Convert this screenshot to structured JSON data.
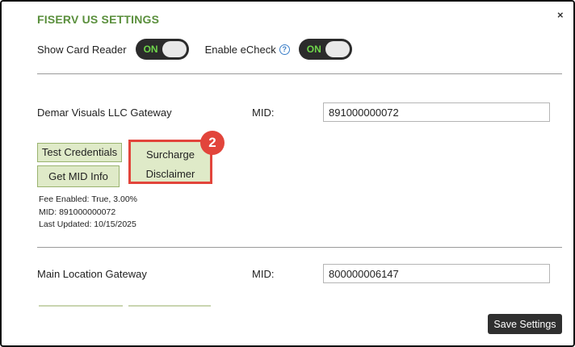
{
  "header": {
    "title": "FISERV US SETTINGS",
    "close_glyph": "×"
  },
  "toggles": {
    "card_reader": {
      "label": "Show Card Reader",
      "state": "ON"
    },
    "echeck": {
      "label": "Enable eCheck",
      "help_glyph": "?",
      "state": "ON"
    }
  },
  "gateways": [
    {
      "name": "Demar Visuals LLC Gateway",
      "mid_label": "MID:",
      "mid_value": "891000000072",
      "buttons": {
        "test_credentials": "Test Credentials",
        "get_mid_info": "Get MID Info",
        "surcharge_line1": "Surcharge",
        "surcharge_line2": "Disclaimer"
      },
      "callout_number": "2",
      "info": {
        "fee": "Fee Enabled: True, 3.00%",
        "mid": "MID: 891000000072",
        "updated": "Last Updated: 10/15/2025"
      }
    },
    {
      "name": "Main Location Gateway",
      "mid_label": "MID:",
      "mid_value": "800000006147"
    }
  ],
  "footer": {
    "save_label": "Save Settings"
  },
  "colors": {
    "title": "#5a8f3c",
    "toggle_on": "#6fd64b",
    "highlight": "#e2453b",
    "button_bg": "#dfeac8"
  }
}
